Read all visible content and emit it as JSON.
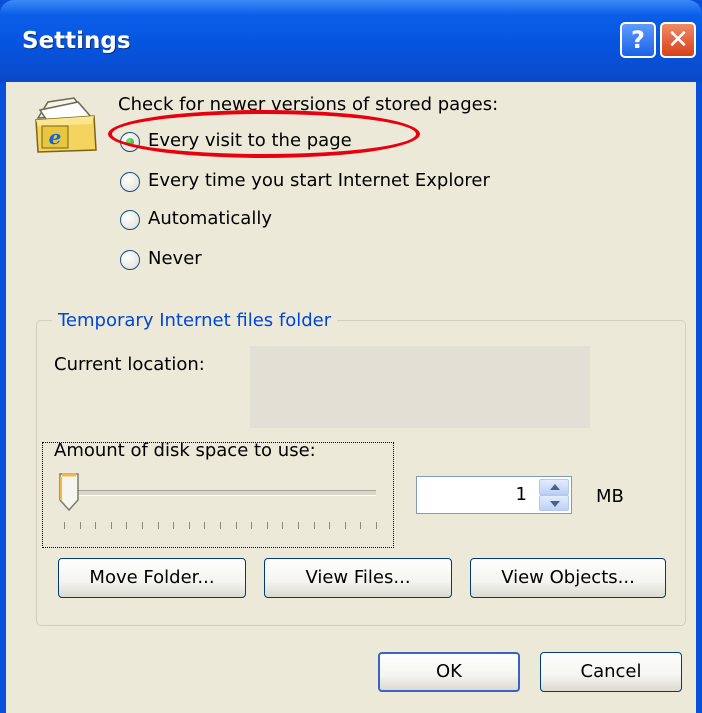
{
  "window": {
    "title": "Settings",
    "help_glyph": "?",
    "close_glyph": "✕"
  },
  "check_section": {
    "heading": "Check for newer versions of stored pages:",
    "icon": "ie-folder-icon",
    "options": [
      {
        "label": "Every visit to the page",
        "selected": true,
        "highlighted": true
      },
      {
        "label": "Every time you start Internet Explorer",
        "selected": false
      },
      {
        "label": "Automatically",
        "selected": false
      },
      {
        "label": "Never",
        "selected": false
      }
    ],
    "highlight_color": "#e8000e"
  },
  "temp_folder": {
    "group_title": "Temporary Internet files folder",
    "current_location_label": "Current location:",
    "current_location_value": "",
    "disk_space_label": "Amount of disk space to use:",
    "slider_level": 0,
    "spin_value": "1",
    "unit": "MB",
    "buttons": {
      "move_folder": "Move Folder...",
      "view_files": "View Files...",
      "view_objects": "View Objects..."
    }
  },
  "footer": {
    "ok": "OK",
    "cancel": "Cancel"
  },
  "colors": {
    "title_bar": "#0654df",
    "client_bg": "#ece9d8",
    "group_title": "#0046d5"
  }
}
